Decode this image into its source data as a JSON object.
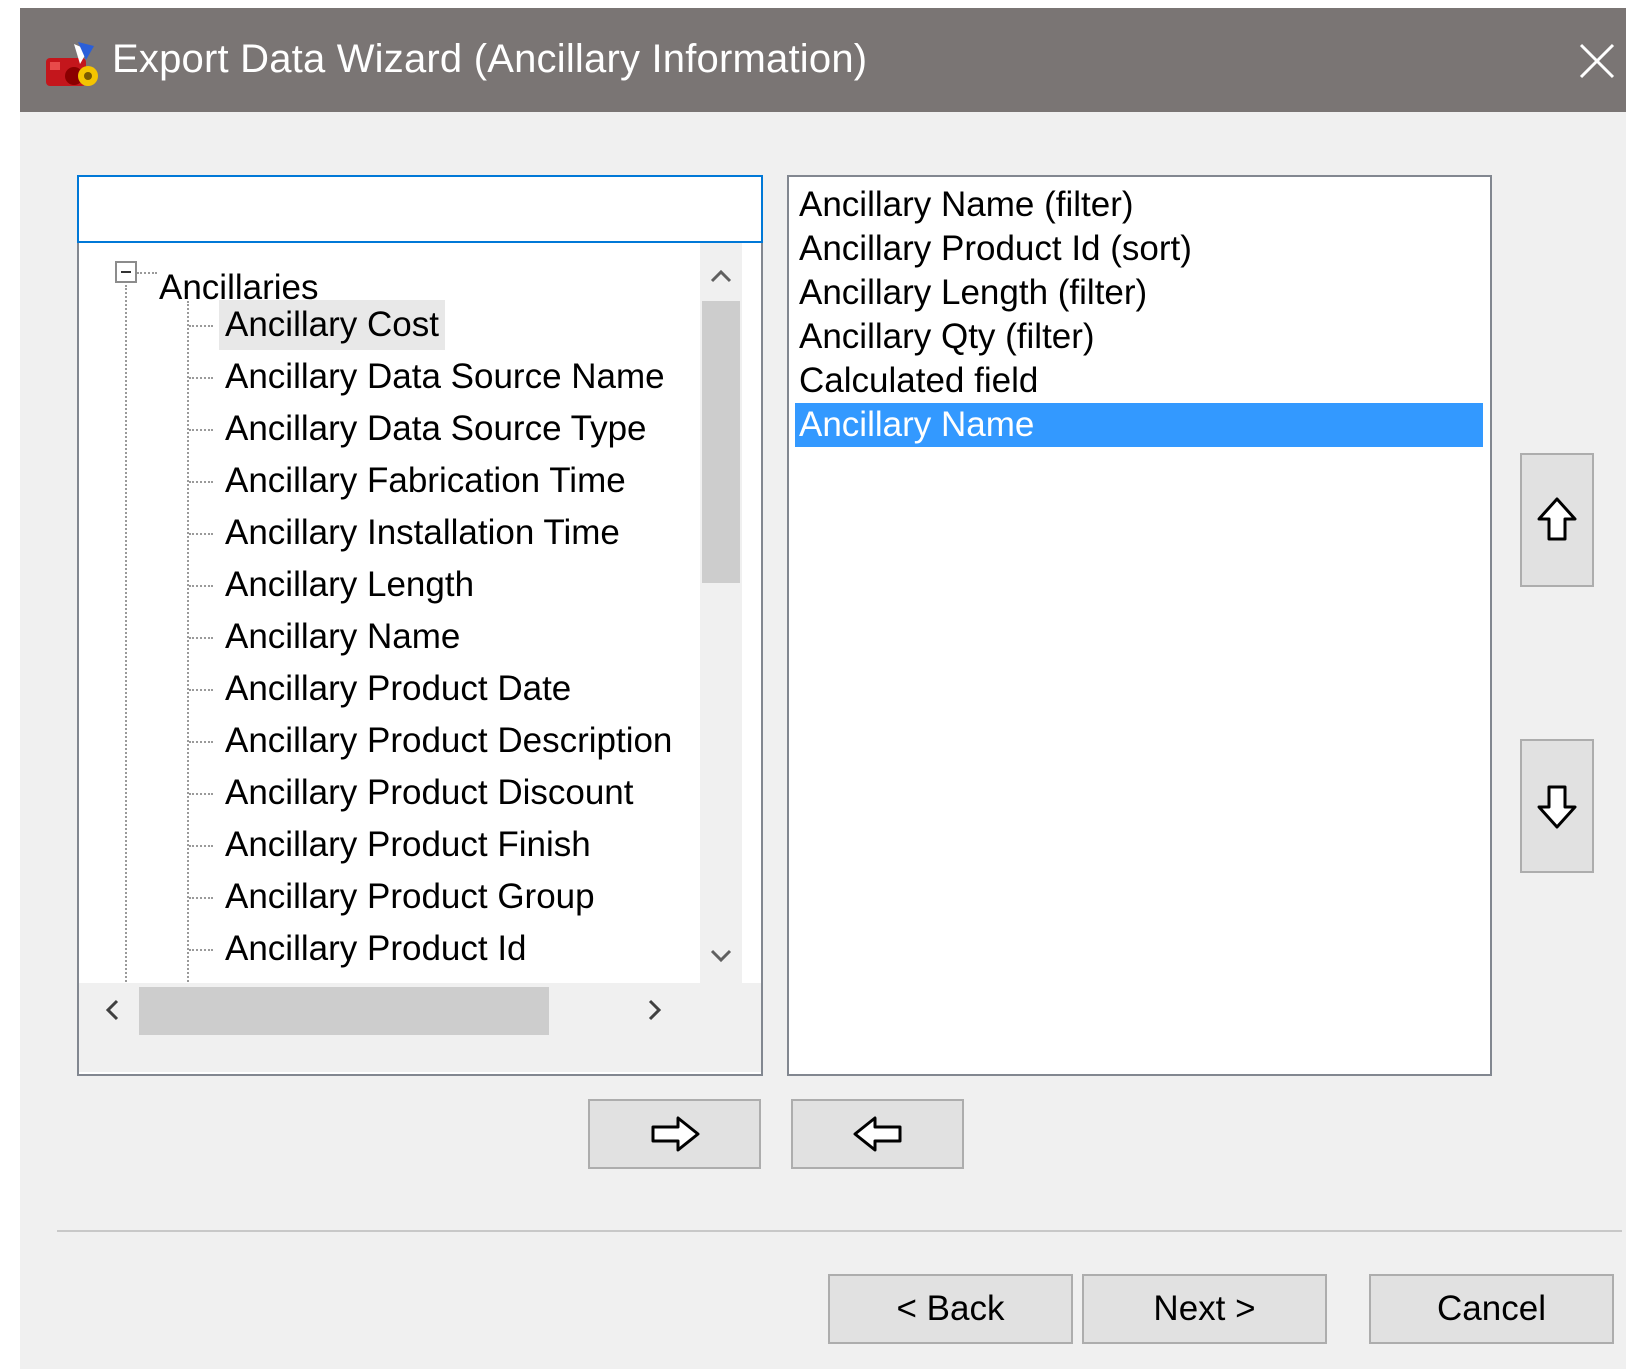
{
  "window": {
    "title": "Export Data Wizard (Ancillary Information)",
    "title_bar_color": "#7a7574"
  },
  "search": {
    "value": ""
  },
  "tree": {
    "root_label": "Ancillaries",
    "items": [
      "Ancillary Cost",
      "Ancillary Data Source Name",
      "Ancillary Data Source Type",
      "Ancillary Fabrication Time",
      "Ancillary Installation Time",
      "Ancillary Length",
      "Ancillary Name",
      "Ancillary Product Date",
      "Ancillary Product Description",
      "Ancillary Product Discount",
      "Ancillary Product Finish",
      "Ancillary Product Group",
      "Ancillary Product Id"
    ],
    "highlighted_item": "Ancillary Cost"
  },
  "selected_fields": {
    "items": [
      "Ancillary Name (filter)",
      "Ancillary Product Id (sort)",
      "Ancillary Length (filter)",
      "Ancillary Qty (filter)",
      "Calculated field",
      "Ancillary Name"
    ],
    "selected_item": "Ancillary Name",
    "selection_color": "#3399ff"
  },
  "buttons": {
    "add_icon": "arrow-right-icon",
    "remove_icon": "arrow-left-icon",
    "move_up_icon": "arrow-up-icon",
    "move_down_icon": "arrow-down-icon",
    "back_label": "< Back",
    "next_label": "Next >",
    "cancel_label": "Cancel"
  }
}
